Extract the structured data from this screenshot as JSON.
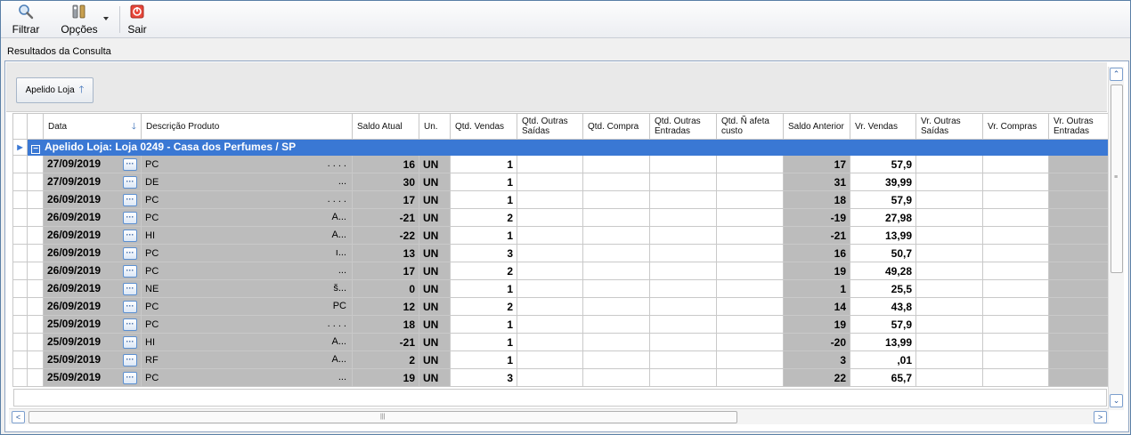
{
  "toolbar": {
    "filter_label": "Filtrar",
    "options_label": "Opções",
    "exit_label": "Sair"
  },
  "section_title": "Resultados da Consulta",
  "group_button": {
    "label": "Apelido Loja"
  },
  "columns": {
    "data": "Data",
    "descricao": "Descrição Produto",
    "saldo_atual": "Saldo Atual",
    "un": "Un.",
    "qtd_vendas": "Qtd. Vendas",
    "qtd_outras_saidas": "Qtd. Outras Saídas",
    "qtd_compra": "Qtd. Compra",
    "qtd_outras_entradas": "Qtd. Outras Entradas",
    "qtd_nafeta_custo": "Qtd. Ñ afeta custo",
    "saldo_anterior": "Saldo Anterior",
    "vr_vendas": "Vr. Vendas",
    "vr_outras_saidas": "Vr. Outras Saídas",
    "vr_compras": "Vr. Compras",
    "vr_outras_entradas": "Vr. Outras Entradas"
  },
  "group_row": {
    "label": "Apelido Loja: Loja 0249 - Casa dos Perfumes / SP"
  },
  "rows": [
    {
      "data": "27/09/2019",
      "desc": "PC",
      "desc_tail": ". . . .",
      "saldo_atual": "16",
      "un": "UN",
      "qtd_vendas": "1",
      "saldo_anterior": "17",
      "vr_vendas": "57,9"
    },
    {
      "data": "27/09/2019",
      "desc": "DE",
      "desc_tail": "...",
      "saldo_atual": "30",
      "un": "UN",
      "qtd_vendas": "1",
      "saldo_anterior": "31",
      "vr_vendas": "39,99"
    },
    {
      "data": "26/09/2019",
      "desc": "PC",
      "desc_tail": ". . . .",
      "saldo_atual": "17",
      "un": "UN",
      "qtd_vendas": "1",
      "saldo_anterior": "18",
      "vr_vendas": "57,9"
    },
    {
      "data": "26/09/2019",
      "desc": "PC",
      "desc_tail": "A...",
      "saldo_atual": "-21",
      "un": "UN",
      "qtd_vendas": "2",
      "saldo_anterior": "-19",
      "vr_vendas": "27,98"
    },
    {
      "data": "26/09/2019",
      "desc": "HI",
      "desc_tail": "A...",
      "saldo_atual": "-22",
      "un": "UN",
      "qtd_vendas": "1",
      "saldo_anterior": "-21",
      "vr_vendas": "13,99"
    },
    {
      "data": "26/09/2019",
      "desc": "PC",
      "desc_tail": "ı...",
      "saldo_atual": "13",
      "un": "UN",
      "qtd_vendas": "3",
      "saldo_anterior": "16",
      "vr_vendas": "50,7"
    },
    {
      "data": "26/09/2019",
      "desc": "PC",
      "desc_tail": "...",
      "saldo_atual": "17",
      "un": "UN",
      "qtd_vendas": "2",
      "saldo_anterior": "19",
      "vr_vendas": "49,28"
    },
    {
      "data": "26/09/2019",
      "desc": "NE",
      "desc_tail": "š...",
      "saldo_atual": "0",
      "un": "UN",
      "qtd_vendas": "1",
      "saldo_anterior": "1",
      "vr_vendas": "25,5"
    },
    {
      "data": "26/09/2019",
      "desc": "PC",
      "desc_tail": "PC",
      "saldo_atual": "12",
      "un": "UN",
      "qtd_vendas": "2",
      "saldo_anterior": "14",
      "vr_vendas": "43,8"
    },
    {
      "data": "25/09/2019",
      "desc": "PC",
      "desc_tail": ". . . .",
      "saldo_atual": "18",
      "un": "UN",
      "qtd_vendas": "1",
      "saldo_anterior": "19",
      "vr_vendas": "57,9"
    },
    {
      "data": "25/09/2019",
      "desc": "HI",
      "desc_tail": "A...",
      "saldo_atual": "-21",
      "un": "UN",
      "qtd_vendas": "1",
      "saldo_anterior": "-20",
      "vr_vendas": "13,99"
    },
    {
      "data": "25/09/2019",
      "desc": "RF",
      "desc_tail": "A...",
      "saldo_atual": "2",
      "un": "UN",
      "qtd_vendas": "1",
      "saldo_anterior": "3",
      "vr_vendas": ",01"
    },
    {
      "data": "25/09/2019",
      "desc": "PC",
      "desc_tail": "...",
      "saldo_atual": "19",
      "un": "UN",
      "qtd_vendas": "3",
      "saldo_anterior": "22",
      "vr_vendas": "65,7"
    }
  ]
}
